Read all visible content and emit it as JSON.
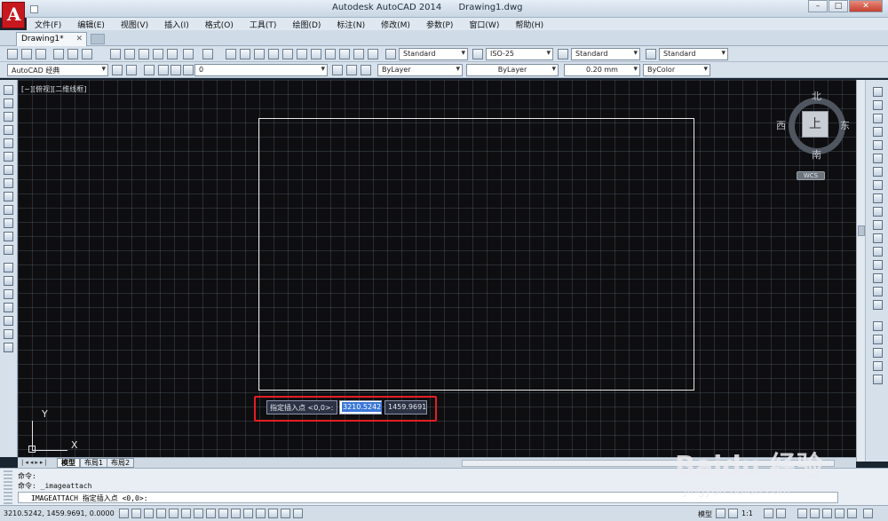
{
  "window": {
    "app_title": "Autodesk AutoCAD 2014",
    "file_title": "Drawing1.dwg",
    "min": "–",
    "max": "□",
    "close": "✕"
  },
  "menu": [
    "文件(F)",
    "编辑(E)",
    "视图(V)",
    "插入(I)",
    "格式(O)",
    "工具(T)",
    "绘图(D)",
    "标注(N)",
    "修改(M)",
    "参数(P)",
    "窗口(W)",
    "帮助(H)"
  ],
  "doc_tab": {
    "label": "Drawing1*",
    "close": "✕"
  },
  "toolbar1": {
    "text_style": "Standard",
    "dim_style": "ISO-25",
    "table_style": "Standard",
    "mleader_style": "Standard"
  },
  "toolbar2": {
    "workspace": "AutoCAD 经典",
    "layer": "0",
    "color": "ByLayer",
    "linetype": "ByLayer",
    "lineweight": "0.20 mm",
    "plotstyle": "ByColor"
  },
  "viewport": {
    "label": "[−][俯视][二维线框]"
  },
  "viewcube": {
    "north": "北",
    "south": "南",
    "east": "东",
    "west": "西",
    "face": "上",
    "wcs": "WCS"
  },
  "ucs": {
    "x": "X",
    "y": "Y"
  },
  "dynamic_input": {
    "prompt": "指定插入点 <0,0>:",
    "x_value": "3210.5242",
    "y_value": "1459.9691"
  },
  "layout_tabs": {
    "model": "模型",
    "layout1": "布局1",
    "layout2": "布局2"
  },
  "command": {
    "line1": "命令:",
    "line2": "命令: _imageattach",
    "current": "IMAGEATTACH 指定插入点 <0,0>:"
  },
  "status": {
    "coords": "3210.5242, 1459.9691, 0.0000",
    "model_label": "模型",
    "scale": "1:1"
  },
  "watermark": {
    "brand": "Baidu 经验",
    "url": "jingyan.baidu.com"
  },
  "colors": {
    "canvas_bg": "#0e0e10",
    "highlight": "#e21f24",
    "autocad_red": "#c8181f",
    "selection": "#3b77d6"
  }
}
